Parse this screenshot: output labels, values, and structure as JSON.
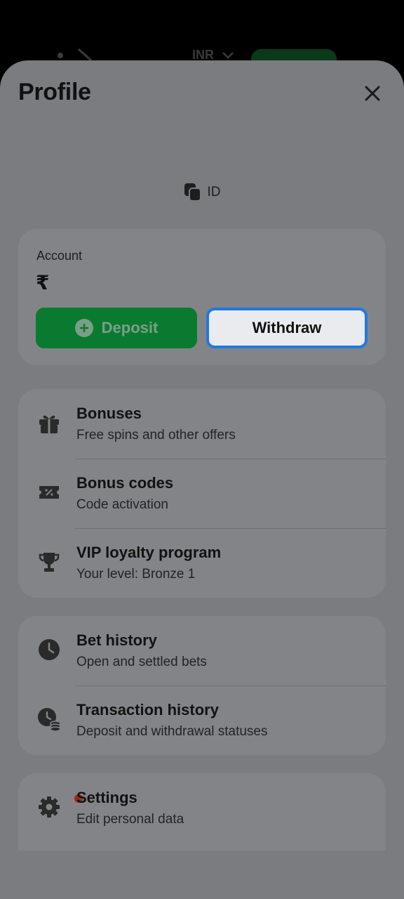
{
  "background": {
    "currency": "INR"
  },
  "sheet": {
    "title": "Profile",
    "id_label": "ID"
  },
  "account": {
    "label": "Account",
    "balance": "₹",
    "deposit_label": "Deposit",
    "withdraw_label": "Withdraw"
  },
  "menu_group_1": [
    {
      "title": "Bonuses",
      "subtitle": "Free spins and other offers",
      "icon": "gift-icon"
    },
    {
      "title": "Bonus codes",
      "subtitle": "Code activation",
      "icon": "coupon-icon"
    },
    {
      "title": "VIP loyalty program",
      "subtitle": "Your level: Bronze 1",
      "icon": "trophy-icon"
    }
  ],
  "menu_group_2": [
    {
      "title": "Bet history",
      "subtitle": "Open and settled bets",
      "icon": "clock-icon"
    },
    {
      "title": "Transaction history",
      "subtitle": "Deposit and withdrawal statuses",
      "icon": "clock-coins-icon"
    }
  ],
  "menu_group_3": [
    {
      "title": "Settings",
      "subtitle": "Edit personal data",
      "icon": "gear-icon"
    }
  ],
  "colors": {
    "sheet_bg": "#7b7c80",
    "card_bg": "#838488",
    "deposit_green": "#0a7a30",
    "withdraw_border": "#1f7ae0",
    "notification_dot": "#a02818"
  }
}
